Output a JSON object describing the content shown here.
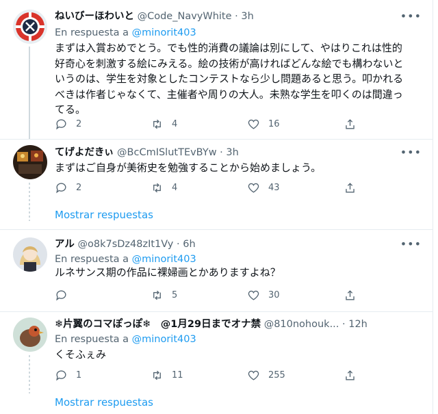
{
  "tweets": [
    {
      "name": "ねいびーほわいと",
      "handle": "@Code_NavyWhite",
      "time": "3h",
      "reply_label": "En respuesta a",
      "reply_to": "@minorit403",
      "text": "まずは入賞おめでとう。でも性的消費の議論は別にして、やはりこれは性的好奇心を刺激する絵にみえる。絵の技術が高ければどんな絵でも構わないというのは、学生を対象としたコンテストなら少し問題あると思う。叩かれるべきは作者じゃなくて、主催者や周りの大人。未熟な学生を叩くのは間違ってる。",
      "replies": "2",
      "retweets": "4",
      "likes": "16"
    },
    {
      "name": "てげよだきぃ",
      "handle": "@BcCmISlutTEvBYw",
      "time": "3h",
      "text": "まずはご自身が美術史を勉強することから始めましょう。",
      "replies": "2",
      "retweets": "4",
      "likes": "43"
    },
    {
      "name": "アル",
      "handle": "@o8k7sDz48zIt1Vy",
      "time": "6h",
      "reply_label": "En respuesta a",
      "reply_to": "@minorit403",
      "text": "ルネサンス期の作品に裸婦画とかありますよね？",
      "replies": "",
      "retweets": "5",
      "likes": "30"
    },
    {
      "name": "❄片翼のコマぽっぽ❄　@1月29日までオナ禁",
      "handle": "@810nohouk...",
      "time": "12h",
      "reply_label": "En respuesta a",
      "reply_to": "@minorit403",
      "text": "くそふぇみ",
      "replies": "1",
      "retweets": "11",
      "likes": "255"
    }
  ],
  "show_replies_label": "Mostrar respuestas",
  "more_glyph": "•••",
  "dot_sep": "·",
  "icons": [
    "reply-icon",
    "retweet-icon",
    "like-icon",
    "share-icon",
    "more-icon"
  ],
  "colors": {
    "link": "#1d9bf0",
    "muted": "#536471",
    "text": "#0f1419",
    "divider": "#e6ecf0"
  }
}
